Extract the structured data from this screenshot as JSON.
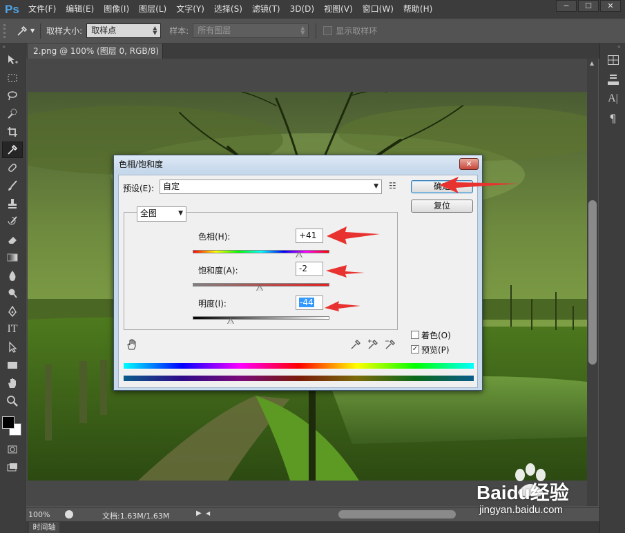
{
  "app": {
    "logo": "Ps",
    "menu": [
      "文件(F)",
      "编辑(E)",
      "图像(I)",
      "图层(L)",
      "文字(Y)",
      "选择(S)",
      "滤镜(T)",
      "3D(D)",
      "视图(V)",
      "窗口(W)",
      "帮助(H)"
    ],
    "window_buttons": [
      "−",
      "☐",
      "✕"
    ]
  },
  "options_bar": {
    "sample_size_label": "取样大小:",
    "sample_size_value": "取样点",
    "sample_label": "样本:",
    "sample_value": "所有图层",
    "show_ring_label": "显示取样环"
  },
  "document": {
    "tab_title": "2.png @ 100% (图层 0, RGB/8)",
    "tab_close": "×"
  },
  "status": {
    "zoom": "100%",
    "doc_info": "文档:1.63M/1.63M",
    "timeline": "时间轴"
  },
  "dialog": {
    "title": "色相/饱和度",
    "close": "✕",
    "preset_label": "预设(E):",
    "preset_value": "自定",
    "ok_button": "确定",
    "reset_button": "复位",
    "channel_value": "全图",
    "hue_label": "色相(H):",
    "hue_value": "+41",
    "saturation_label": "饱和度(A):",
    "saturation_value": "-2",
    "lightness_label": "明度(I):",
    "lightness_value": "-44",
    "colorize_label": "着色(O)",
    "colorize_checked": false,
    "preview_label": "预览(P)",
    "preview_checked": true,
    "sliders": {
      "hue_fraction": 0.78,
      "saturation_fraction": 0.49,
      "lightness_fraction": 0.28
    }
  },
  "watermark": {
    "brand": "Baidu经验",
    "url": "jingyan.baidu.com"
  },
  "colors": {
    "menubar": "#3c3c3c",
    "panel": "#535353",
    "annotation_arrow": "#e8322f",
    "dialog_frame": "#c7d9ec"
  }
}
